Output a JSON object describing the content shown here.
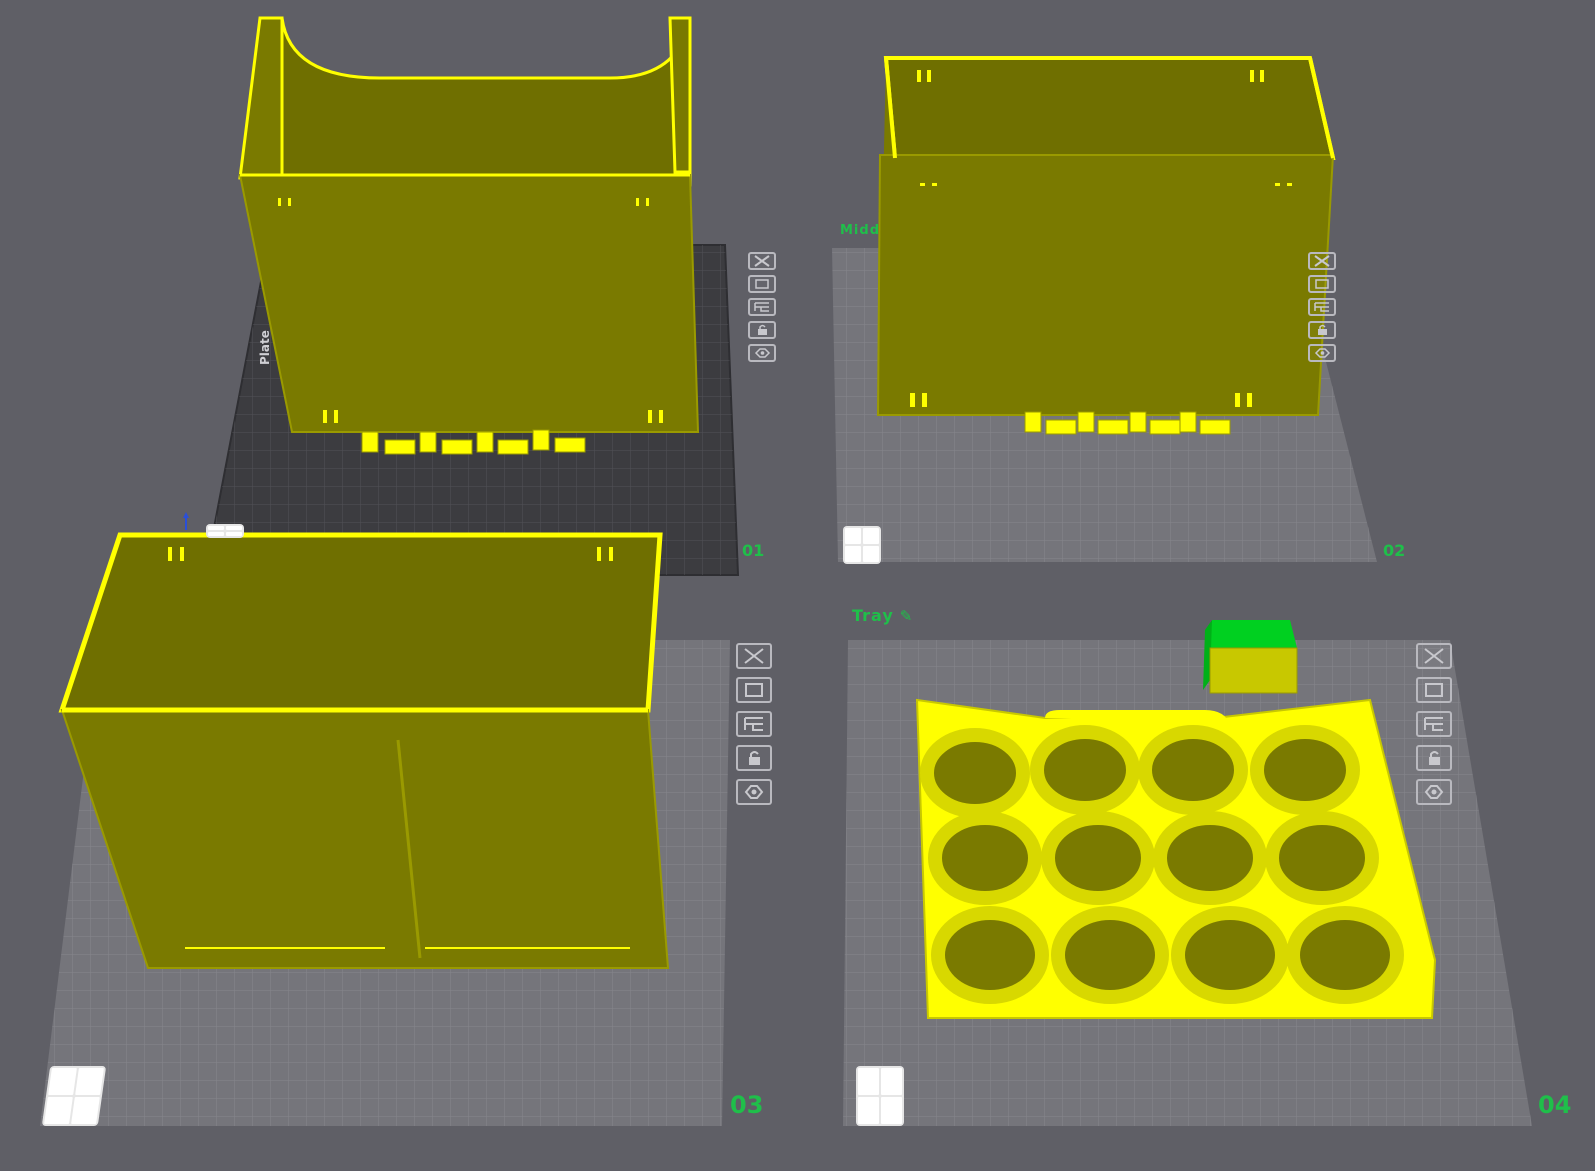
{
  "plates": [
    {
      "id": "plate-1",
      "number": "01",
      "name": "",
      "active": true
    },
    {
      "id": "plate-2",
      "number": "02",
      "name": "Midd",
      "active": false
    },
    {
      "id": "plate-3",
      "number": "03",
      "name": "",
      "active": false
    },
    {
      "id": "plate-4",
      "number": "04",
      "name": "Tray",
      "active": false
    }
  ],
  "plate1_label": "Plate",
  "plate_tools": [
    {
      "name": "remove-plate",
      "icon": "close-icon"
    },
    {
      "name": "arrange-plate",
      "icon": "arrange-icon"
    },
    {
      "name": "plate-settings",
      "icon": "layout-icon"
    },
    {
      "name": "lock-plate",
      "icon": "lock-icon"
    },
    {
      "name": "plate-visibility",
      "icon": "eye-icon"
    }
  ],
  "colors": {
    "background": "#5f5f66",
    "plate_dark": "#3c3c40",
    "plate_light": "#75757b",
    "model": "#7a7a00",
    "model_edge": "#ffff00",
    "accent_green": "#1fbf4a"
  },
  "edit_icon": "pencil-icon"
}
